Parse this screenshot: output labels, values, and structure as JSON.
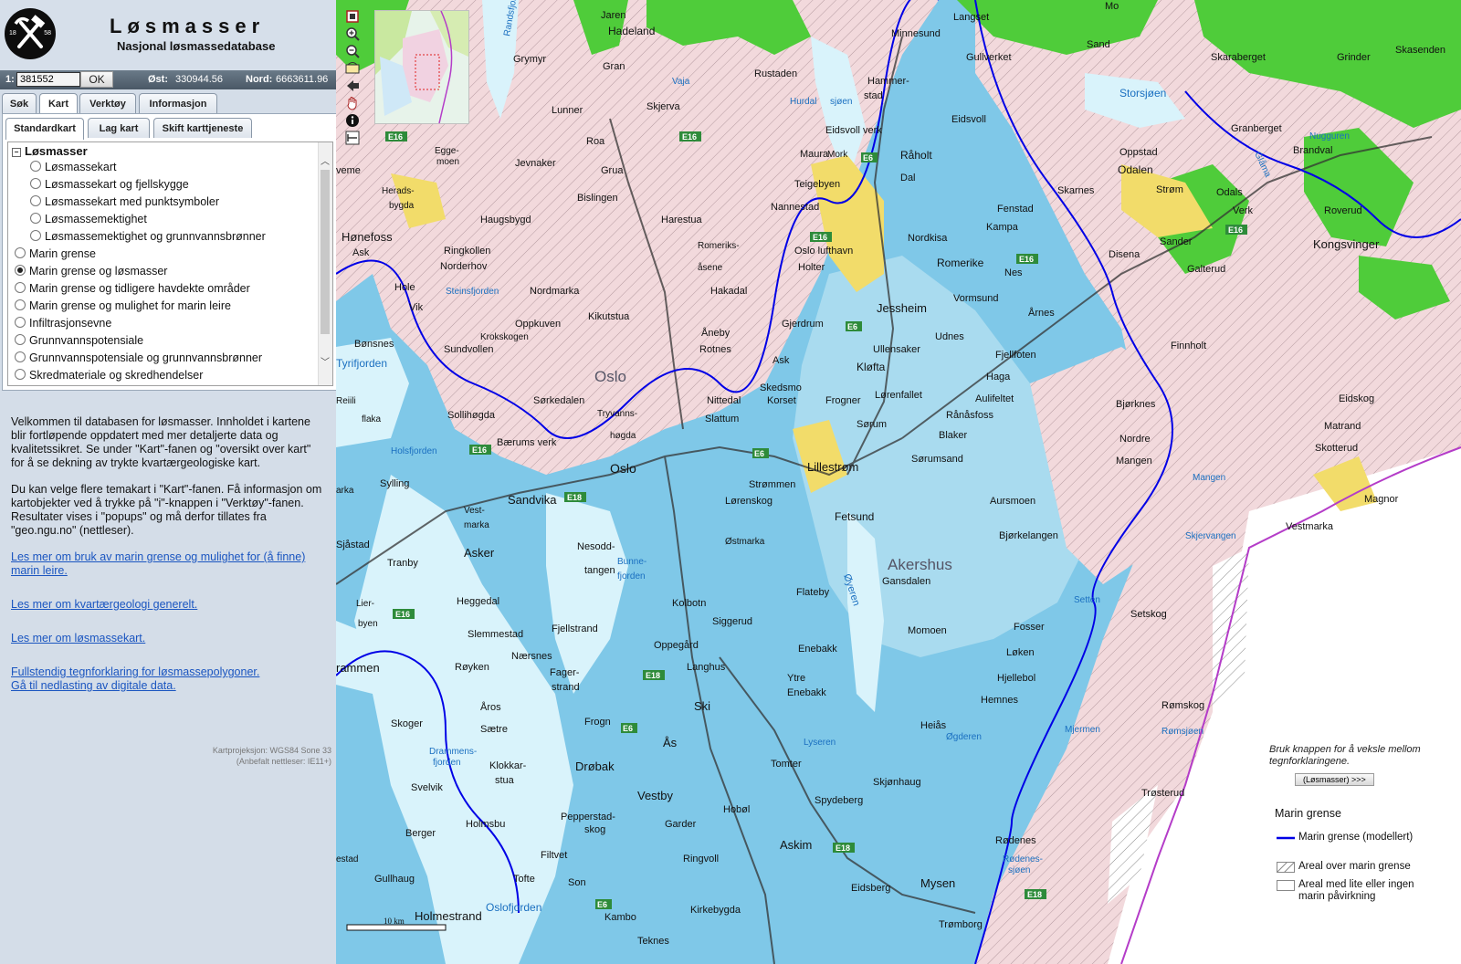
{
  "app": {
    "title": "Løsmasser",
    "subtitle": "Nasjonal løsmassedatabase",
    "logo_year_left": "18",
    "logo_year_right": "58"
  },
  "coords": {
    "scale_prefix": "1:",
    "scale_value": "381552",
    "ok_label": "OK",
    "east_label": "Øst:",
    "east_value": "330944.56",
    "north_label": "Nord:",
    "north_value": "6663611.96"
  },
  "tabs": [
    {
      "label": "Søk"
    },
    {
      "label": "Kart"
    },
    {
      "label": "Verktøy"
    },
    {
      "label": "Informasjon"
    }
  ],
  "subtabs": [
    {
      "label": "Standardkart"
    },
    {
      "label": "Lag kart"
    },
    {
      "label": "Skift karttjeneste"
    }
  ],
  "layers": {
    "group": "Løsmasser",
    "group_toggle": "−",
    "sub_items": [
      {
        "label": "Løsmassekart"
      },
      {
        "label": "Løsmassekart og fjellskygge"
      },
      {
        "label": "Løsmassekart med punktsymboler"
      },
      {
        "label": "Løsmassemektighet"
      },
      {
        "label": "Løsmassemektighet og grunnvannsbrønner"
      }
    ],
    "items": [
      {
        "label": "Marin grense"
      },
      {
        "label": "Marin grense og løsmasser"
      },
      {
        "label": "Marin grense og tidligere havdekte områder"
      },
      {
        "label": "Marin grense og mulighet for marin leire"
      },
      {
        "label": "Infiltrasjonsevne"
      },
      {
        "label": "Grunnvannspotensiale"
      },
      {
        "label": "Grunnvannspotensiale og grunnvannsbrønner"
      },
      {
        "label": "Skredmateriale og skredhendelser"
      }
    ],
    "selected": "Marin grense og løsmasser"
  },
  "info": {
    "p1": "Velkommen til databasen for løsmasser. Innholdet i kartene blir fortløpende oppdatert med mer detaljerte data og kvalitetssikret. Se under \"Kart\"-fanen og \"oversikt over kart\" for å se dekning av trykte kvartærgeologiske kart.",
    "p2": "Du kan velge flere temakart i \"Kart\"-fanen. Få informasjon om kartobjekter ved å trykke på \"i\"-knappen i \"Verktøy\"-fanen. Resultater vises i \"popups\" og må derfor tillates fra \"geo.ngu.no\" (nettleser).",
    "link1": "Les mer om bruk av marin grense og mulighet for (å finne) marin leire.",
    "link2": "Les mer om kvartærgeologi generelt.",
    "link3": "Les mer om løsmassekart.",
    "link4a": "Fullstendig tegnforklaring for løsmassepolygoner.",
    "link4b": "Gå til nedlasting av digitale data.",
    "projection": "Kartprojeksjon: WGS84 Sone 33",
    "browser": "(Anbefalt nettleser: IE11+)"
  },
  "toolbar": {
    "icons": [
      "fullextent-icon",
      "zoom-in-icon",
      "zoom-out-icon",
      "zoom-box-icon",
      "back-icon",
      "pan-icon",
      "info-icon",
      "measure-icon"
    ]
  },
  "legend": {
    "hint": "Bruk knappen for å veksle mellom tegnforklaringene.",
    "button": "(Løsmasser) >>>",
    "title": "Marin grense",
    "rows": [
      {
        "label": "Marin grense (modellert)"
      },
      {
        "label": "Areal over marin grense"
      },
      {
        "label": "Areal med lite eller ingen marin påvirkning"
      }
    ]
  },
  "map": {
    "scalebar": "10 km",
    "places": {
      "oslo": "Oslo",
      "oslo_city": "Oslo",
      "akershus": "Akershus",
      "lillestrom": "Lillestrøm",
      "jessheim": "Jessheim",
      "kongsvinger": "Kongsvinger",
      "honefoss": "Hønefoss",
      "drammen": "rammen",
      "sandvika": "Sandvika",
      "asker": "Asker",
      "ski": "Ski",
      "as": "Ås",
      "drobak": "Drøbak",
      "vestby": "Vestby",
      "askim": "Askim",
      "mysen": "Mysen",
      "holmestrand": "Holmestrand",
      "oslofjorden": "Oslofjorden",
      "fetsund": "Fetsund",
      "klofta": "Kløfta",
      "eidsvoll_verk": "Eidsvoll verk",
      "raholt": "Råholt",
      "eidsvoll": "Eidsvoll",
      "minnesund": "Minnesund",
      "hadeland": "Hadeland",
      "jaren": "Jaren",
      "gran": "Gran",
      "roa": "Roa",
      "lunner": "Lunner",
      "skjerva": "Skjerva",
      "grua": "Grua",
      "bislingen": "Bislingen",
      "harestua": "Harestua",
      "hurdalsjoen": "Hurdalsjøen",
      "nannestad": "Nannestad",
      "maura": "Maura",
      "teigebyen": "Teigebyen",
      "oslo_lufthavn": "Oslo lufthavn",
      "holter": "Holter",
      "gjerdrum": "Gjerdrum",
      "hakadal": "Hakadal",
      "romerike": "Romerike",
      "nordkisa": "Nordkisa",
      "fenstad": "Fenstad",
      "kampa": "Kampa",
      "nes": "Nes",
      "vormsund": "Vormsund",
      "arnes": "Årnes",
      "udnes": "Udnes",
      "ullensaker": "Ullensaker",
      "fjellfoten": "Fjellfoten",
      "haga": "Haga",
      "aulifeltet": "Aulifeltet",
      "ranasfoss": "Rånåsfoss",
      "blaker": "Blaker",
      "sorumsand": "Sørumsand",
      "sorum": "Sørum",
      "lorenfallet": "Lørenfallet",
      "frogner": "Frogner",
      "skedsmo": "Skedsmo",
      "korset": "Korset",
      "nittedal": "Nittedal",
      "slattum": "Slattum",
      "strommen": "Strømmen",
      "lorenskog": "Lørenskog",
      "rotnes": "Rotnes",
      "aneby": "Åneby",
      "kikutstua": "Kikutstua",
      "nordmarka": "Nordmarka",
      "norderhov": "Norderhov",
      "ringkollen": "Ringkollen",
      "haugsbygd": "Haugsbygd",
      "jevnaker": "Jevnaker",
      "grymyr": "Grymyr",
      "bonsnes": "Bønsnes",
      "sundvollen": "Sundvollen",
      "krokskogen": "Krokskogen",
      "oppkuven": "Oppkuven",
      "steinsfjorden": "Steinsfjorden",
      "tyrifjorden": "Tyrifjorden",
      "sollihogda": "Sollihøgda",
      "baerums_verk": "Bærums verk",
      "sorkedalen": "Sørkedalen",
      "tryvannsh": "Tryvanns-",
      "hoeda": "høgda",
      "holsfjorden": "Holsfjorden",
      "sylling": "Sylling",
      "sjastad": "Sjåstad",
      "tranby": "Tranby",
      "heggedal": "Heggedal",
      "slemmestad": "Slemmestad",
      "naersnes": "Nærsnes",
      "royken": "Røyken",
      "aros": "Åros",
      "saetre": "Sætre",
      "skoger": "Skoger",
      "drammensfjorden": "Drammens-",
      "fjorden": "fjorden",
      "klokkar": "Klokkar-",
      "stua": "stua",
      "svelvik": "Svelvik",
      "holmsbu": "Holmsbu",
      "berger": "Berger",
      "gullhaug": "Gullhaug",
      "filtvet": "Filtvet",
      "tofte": "Tofte",
      "son": "Son",
      "kambo": "Kambo",
      "pepperstad": "Pepperstad-",
      "skog": "skog",
      "nesodd": "Nesodd-",
      "tangen": "tangen",
      "bunne": "Bunne-",
      "fjorden2": "fjorden",
      "fjellstrand": "Fjellstrand",
      "fager": "Fager-",
      "strand": "strand",
      "kolbotn": "Kolbotn",
      "oppegard": "Oppegård",
      "siggerud": "Siggerud",
      "langhus": "Langhus",
      "frogn": "Frogn",
      "tomter": "Tomter",
      "hobol": "Hobøl",
      "garder": "Garder",
      "ringvoll": "Ringvoll",
      "kirkebygda": "Kirkebygda",
      "teknes": "Teknes",
      "spydeberg": "Spydeberg",
      "skjonhaug": "Skjønhaug",
      "eidsberg": "Eidsberg",
      "tromborg": "Trømborg",
      "rodenes": "Rødenes",
      "rodenessjoen": "Rødenes-",
      "sjoen": "sjøen",
      "ogderen": "Øgderen",
      "lyseren": "Lyseren",
      "enebakk": "Enebakk",
      "ytre": "Ytre",
      "enebakk2": "Enebakk",
      "flateby": "Flateby",
      "oyeren": "Øyeren",
      "gansdalen": "Gansdalen",
      "momoen": "Momoen",
      "heiås": "Heiås",
      "hemnes": "Hemnes",
      "hjellebol": "Hjellebol",
      "loken": "Løken",
      "fosser": "Fosser",
      "setten": "Setten",
      "setskog": "Setskog",
      "romskog": "Rømskog",
      "romsjoen": "Rømsjøen",
      "mjermen": "Mjermen",
      "trosterud": "Trøsterud",
      "bjorkelangen": "Bjørkelangen",
      "aursmoen": "Aursmoen",
      "vestmarka": "Vestmarka",
      "skjervangen": "Skjervangen",
      "mangen": "Mangen",
      "magnor": "Magnor",
      "skotterud": "Skotterud",
      "matrand": "Matrand",
      "eidskog": "Eidskog",
      "nordre": "Nordre",
      "mangen2": "Mangen",
      "bjorknes": "Bjørknes",
      "finnholt": "Finnholt",
      "disena": "Disena",
      "sander": "Sander",
      "galterud": "Galterud",
      "odalen": "Odalen",
      "oppstad": "Oppstad",
      "skarnes": "Skarnes",
      "strom": "Strøm",
      "odals": "Odals",
      "verk": "Verk",
      "roverud": "Roverud",
      "glama": "Glåma",
      "storsjoen": "Storsjøen",
      "skaraberget": "Skaraberget",
      "granberget": "Granberget",
      "brandval": "Brandval",
      "nugguren": "Nugguren",
      "grinder": "Grinder",
      "skasenden": "Skasenden",
      "sand": "Sand",
      "mo": "Mo",
      "langset": "Langset",
      "gullverket": "Gullverket",
      "hammerstad": "Hammer-",
      "stad": "stad",
      "rustaden": "Rustaden",
      "vaja": "Vaja",
      "hurdal": "Hurdal",
      "vora": "Vora",
      "egge": "Egge-",
      "moen": "moen",
      "heradsbygda": "Herads-",
      "bygda": "bygda",
      "ask": "Ask",
      "hole": "Hole",
      "vik": "Vik",
      "randsfjorden": "Randsfjorden",
      "vemme": "veme",
      "lierbyen": "Lier-",
      "byen": "byen",
      "flaka": "flaka",
      "reiili": "Reiili",
      "arka": "arka",
      "estad": "estad",
      "ostmarka": "Østmarka",
      "vestmarka2": "Vest-",
      "marka2": "marka",
      "romeriks": "Romeriks-",
      "asene": "åsene",
      "ask2": "Ask",
      "dal": "Dal",
      "mork": "Mork",
      "hurdalsjoen2": "sjøen"
    }
  }
}
